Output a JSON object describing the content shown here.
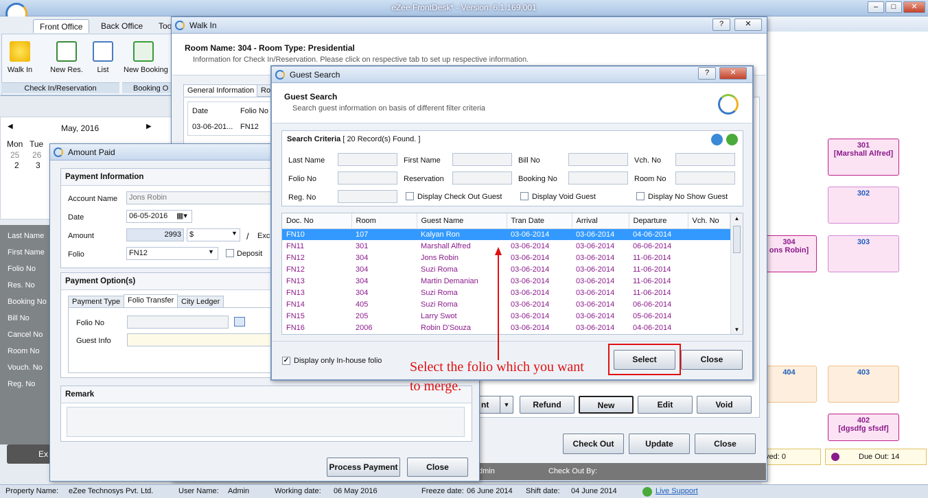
{
  "app": {
    "title": "eZee FrontDesk* - Version: 6.1.169.001"
  },
  "ribbon": {
    "tabs": [
      "Front Office",
      "Back Office",
      "Too"
    ],
    "buttons": [
      "Walk In",
      "New Res.",
      "List",
      "New Booking"
    ],
    "groups": [
      "Check In/Reservation",
      "Booking O"
    ]
  },
  "calendar": {
    "month": "May, 2016",
    "days": [
      "Mon",
      "Tue"
    ],
    "row1": [
      "25",
      "26"
    ],
    "row2": [
      "2",
      "3"
    ]
  },
  "sidebar": {
    "items": [
      "Last Name",
      "First Name",
      "Folio No",
      "Res. No",
      "Booking No",
      "Bill No",
      "Cancel No",
      "Room No",
      "Vouch. No",
      "Reg. No"
    ],
    "bottom_label": "Ex"
  },
  "rooms": [
    {
      "no": "301",
      "guest": "[Marshall Alfred]"
    },
    {
      "no": "302",
      "guest": ""
    },
    {
      "no": "304",
      "guest": "ons Robin]"
    },
    {
      "no": "303",
      "guest": ""
    },
    {
      "no": "404",
      "guest": ""
    },
    {
      "no": "403",
      "guest": ""
    },
    {
      "no": "402",
      "guest": "[dgsdfg sfsdf]"
    }
  ],
  "walkin": {
    "title": "Walk In",
    "heading": "Room Name: 304 - Room Type: Presidential",
    "subtext": "Information for Check In/Reservation. Please click on respective tab to set up respective information.",
    "tabs": [
      "General Information",
      "Ro"
    ],
    "grid_headers": [
      "Date",
      "Folio No"
    ],
    "grid_row": [
      "03-06-201...",
      "FN12"
    ],
    "buttons": {
      "refund": "Refund",
      "new": "New",
      "edit": "Edit",
      "void": "Void",
      "nt": "nt",
      "checkout": "Check Out",
      "update": "Update",
      "close": "Close"
    },
    "footer": {
      "admin": "dmin",
      "checkout_by": "Check Out By:"
    }
  },
  "amount": {
    "title": "Amount Paid",
    "payment_info": "Payment Information",
    "account_name_label": "Account Name",
    "account_name": "Jons Robin",
    "date_label": "Date",
    "date": "06-05-2016",
    "amount_label": "Amount",
    "amount": "2993",
    "currency": "$",
    "slash": "/",
    "exch": "Exch",
    "folio_label": "Folio",
    "folio": "FN12",
    "deposit": "Deposit",
    "payment_options": "Payment Option(s)",
    "tabs": [
      "Payment Type",
      "Folio Transfer",
      "City Ledger"
    ],
    "folio_no_label": "Folio No",
    "guest_info_label": "Guest Info",
    "remark": "Remark",
    "process": "Process Payment",
    "close": "Close"
  },
  "search": {
    "title": "Guest Search",
    "heading": "Guest Search",
    "subtext": "Search guest information on basis of different filter criteria",
    "criteria": "Search Criteria",
    "found": "[ 20 Record(s) Found. ]",
    "fields": [
      "Last Name",
      "First Name",
      "Bill No",
      "Vch. No",
      "Folio No",
      "Reservation",
      "Booking No",
      "Room No",
      "Reg. No"
    ],
    "check_out": "Display Check Out Guest",
    "void": "Display Void Guest",
    "noshow": "Display No Show Guest",
    "headers": [
      "Doc. No",
      "Room",
      "Guest Name",
      "Tran Date",
      "Arrival",
      "Departure",
      "Vch. No"
    ],
    "rows": [
      [
        "FN10",
        "107",
        "Kalyan Ron",
        "03-06-2014",
        "03-06-2014",
        "04-06-2014",
        ""
      ],
      [
        "FN11",
        "301",
        "Marshall Alfred",
        "03-06-2014",
        "03-06-2014",
        "06-06-2014",
        ""
      ],
      [
        "FN12",
        "304",
        "Jons Robin",
        "03-06-2014",
        "03-06-2014",
        "11-06-2014",
        ""
      ],
      [
        "FN12",
        "304",
        "Suzi Roma",
        "03-06-2014",
        "03-06-2014",
        "11-06-2014",
        ""
      ],
      [
        "FN13",
        "304",
        "Martin Demanian",
        "03-06-2014",
        "03-06-2014",
        "11-06-2014",
        ""
      ],
      [
        "FN13",
        "304",
        "Suzi Roma",
        "03-06-2014",
        "03-06-2014",
        "11-06-2014",
        ""
      ],
      [
        "FN14",
        "405",
        "Suzi Roma",
        "03-06-2014",
        "03-06-2014",
        "06-06-2014",
        ""
      ],
      [
        "FN15",
        "205",
        "Larry Swot",
        "03-06-2014",
        "03-06-2014",
        "05-06-2014",
        ""
      ],
      [
        "FN16",
        "2006",
        "Robin D'Souza",
        "03-06-2014",
        "03-06-2014",
        "04-06-2014",
        ""
      ]
    ],
    "inhouse": "Display only In-house folio",
    "select": "Select",
    "close": "Close"
  },
  "annotation": "Select the folio which you want to merge.",
  "status": {
    "property": "Property Name:",
    "company": "eZee Technosys Pvt. Ltd.",
    "user_label": "User Name:",
    "user": "Admin",
    "working_label": "Working date:",
    "working": "06 May 2016",
    "freeze_label": "Freeze date:",
    "freeze": "06 June 2014",
    "shift_label": "Shift date:",
    "shift": "04 June 2014",
    "support": "Live Support",
    "ved": "ved: 0",
    "dueout": "Due Out: 14"
  },
  "colors": {
    "accent": "#3399ff",
    "annotation": "#e01010",
    "row_text": "#8b1a8b"
  }
}
